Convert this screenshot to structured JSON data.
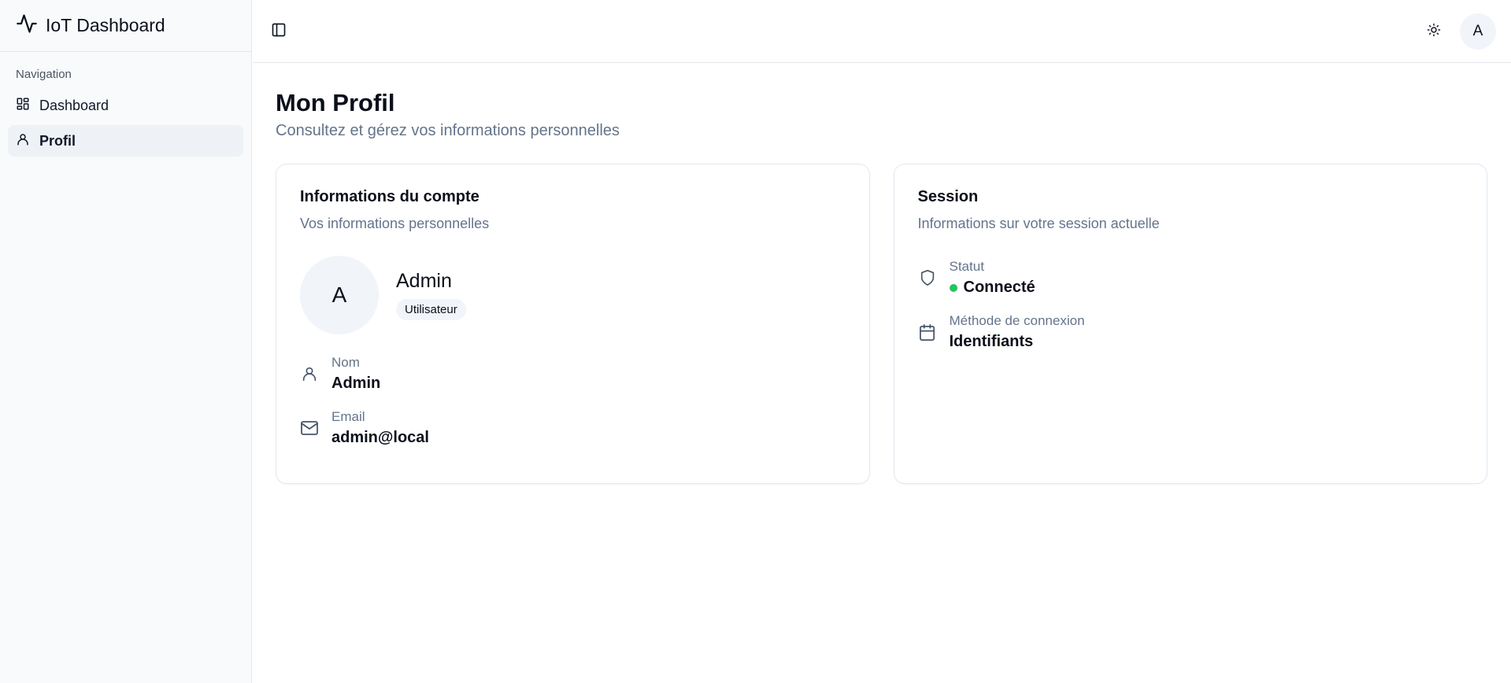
{
  "app": {
    "title": "IoT Dashboard"
  },
  "sidebar": {
    "group_label": "Navigation",
    "items": [
      {
        "label": "Dashboard",
        "icon": "layout-dashboard-icon",
        "active": false
      },
      {
        "label": "Profil",
        "icon": "user-icon",
        "active": true
      }
    ]
  },
  "topbar": {
    "avatar_initial": "A",
    "icons": [
      "sidebar-toggle-icon",
      "sun-icon"
    ]
  },
  "page": {
    "title": "Mon Profil",
    "subtitle": "Consultez et gérez vos informations personnelles"
  },
  "account_card": {
    "title": "Informations du compte",
    "description": "Vos informations personnelles",
    "avatar_initial": "A",
    "name": "Admin",
    "role": "Utilisateur",
    "fields": [
      {
        "label": "Nom",
        "value": "Admin",
        "icon": "user-icon"
      },
      {
        "label": "Email",
        "value": "admin@local",
        "icon": "mail-icon"
      }
    ]
  },
  "session_card": {
    "title": "Session",
    "description": "Informations sur votre session actuelle",
    "fields": [
      {
        "label": "Statut",
        "value": "Connecté",
        "icon": "shield-icon",
        "status_color": "#22c55e"
      },
      {
        "label": "Méthode de connexion",
        "value": "Identifiants",
        "icon": "calendar-icon"
      }
    ]
  },
  "colors": {
    "muted_text": "#64748b",
    "sidebar_bg": "#f8fafc",
    "active_item_bg": "#eef1f5",
    "status_online": "#22c55e"
  }
}
